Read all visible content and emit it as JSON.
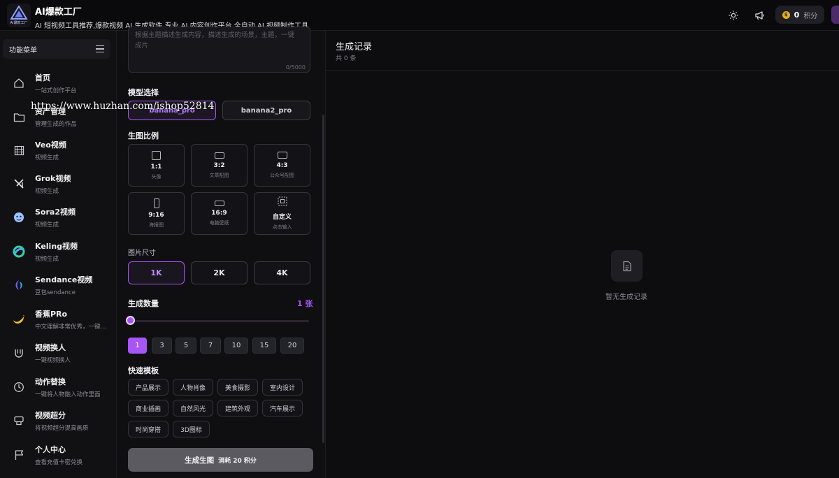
{
  "header": {
    "brand_title": "AI爆款工厂",
    "brand_subtitle": "AI 短视频工具推荐,爆款视频 AI 生成软件,专业 AI 内容创作平台,全自动 AI 视频制作工具",
    "logo_text": "AI爆款工厂",
    "points_value": "0",
    "points_unit": "积分"
  },
  "sidebar": {
    "menu_title": "功能菜单",
    "items": [
      {
        "label": "首页",
        "sub": "一站式创作平台",
        "icon": "home-icon"
      },
      {
        "label": "资产管理",
        "sub": "管理生成的作品",
        "icon": "folder-icon"
      },
      {
        "label": "Veo视频",
        "sub": "视频生成",
        "icon": "film-icon"
      },
      {
        "label": "Grok视频",
        "sub": "视频生成",
        "icon": "grok-logo-icon"
      },
      {
        "label": "Sora2视频",
        "sub": "视频生成",
        "icon": "sora-logo-icon"
      },
      {
        "label": "Keling视频",
        "sub": "视频生成",
        "icon": "keling-logo-icon"
      },
      {
        "label": "Sendance视频",
        "sub": "豆包sendance",
        "icon": "sendance-logo-icon"
      },
      {
        "label": "香蕉PRo",
        "sub": "中文理解非常优秀，一键...",
        "icon": "banana-icon"
      },
      {
        "label": "视频换人",
        "sub": "一键视频换人",
        "icon": "magnet-icon"
      },
      {
        "label": "动作替换",
        "sub": "一键将人物融入动作里面",
        "icon": "clock-icon"
      },
      {
        "label": "视频超分",
        "sub": "将视频超分提高画质",
        "icon": "enhance-icon"
      },
      {
        "label": "个人中心",
        "sub": "查看充值卡密兑换",
        "icon": "flag-icon"
      }
    ]
  },
  "watermark": "https://www.huzhan.com/ishop52814",
  "form": {
    "prompt_placeholder": "根据主题描述生成内容，描述生成的场景，主题，一键成片",
    "prompt_count": "0/5000",
    "model_title": "模型选择",
    "models": [
      "banana_pro",
      "banana2_pro"
    ],
    "ratio_title": "生图比例",
    "ratios": [
      {
        "label": "1:1",
        "sub": "头像"
      },
      {
        "label": "3:2",
        "sub": "文章配图"
      },
      {
        "label": "4:3",
        "sub": "公众号配图"
      },
      {
        "label": "9:16",
        "sub": "海报图"
      },
      {
        "label": "16:9",
        "sub": "电脑壁纸"
      },
      {
        "label": "自定义",
        "sub": "点击输入"
      }
    ],
    "size_title": "图片尺寸",
    "sizes": [
      "1K",
      "2K",
      "4K"
    ],
    "count_title": "生成数量",
    "count_value": "1 张",
    "count_slider_fraction": 0,
    "quantities": [
      "1",
      "3",
      "5",
      "7",
      "10",
      "15",
      "20"
    ],
    "template_title": "快速模板",
    "templates": [
      "产品展示",
      "人物肖像",
      "美食摄影",
      "室内设计",
      "商业插画",
      "自然风光",
      "建筑外观",
      "汽车展示",
      "时尚穿搭",
      "3D图标"
    ],
    "generate_label": "生成生图",
    "generate_cost": "消耗 20 积分"
  },
  "records": {
    "title": "生成记录",
    "count": "共 0 条",
    "empty_text": "暂无生成记录"
  },
  "colors": {
    "accent": "#a855f7",
    "background": "#0c0c0f"
  }
}
